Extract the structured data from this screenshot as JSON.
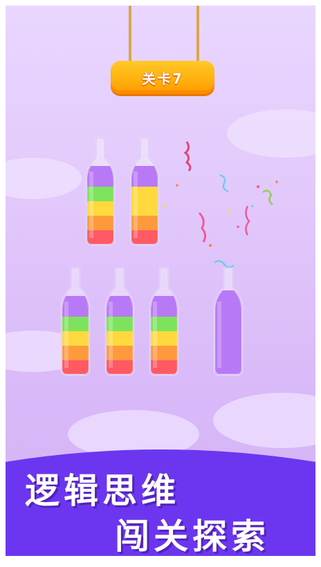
{
  "level": {
    "label": "关卡7"
  },
  "bottles": [
    {
      "layers": [
        "#ff5a63",
        "#ff9a3c",
        "#ffd93d",
        "#7ee35c"
      ],
      "top": "#b879f6"
    },
    {
      "layers": [
        "#ff5a63",
        "#ff9a3c",
        "#ffd93d",
        "#ffd93d"
      ],
      "top": "#b879f6"
    },
    {
      "layers": [
        "#ff5a63",
        "#ff9a3c",
        "#ffd93d",
        "#7ee35c"
      ],
      "top": "#b879f6"
    },
    {
      "layers": [
        "#ff5a63",
        "#ff9a3c",
        "#ffd93d",
        "#7ee35c"
      ],
      "top": "#b879f6"
    },
    {
      "layers": [
        "#ff5a63",
        "#ff9a3c",
        "#ffd93d",
        "#7ee35c"
      ],
      "top": "#b879f6"
    },
    {
      "layers": [],
      "top": "#b879f6",
      "fullColor": "#b879f6"
    }
  ],
  "banner": {
    "line1": "逻辑思维",
    "line2": "闯关探索",
    "color": "#6c36f0"
  }
}
